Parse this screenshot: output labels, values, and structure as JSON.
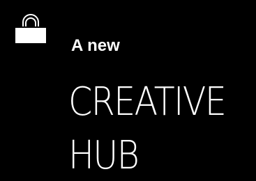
{
  "hero": {
    "icon": "lock-icon",
    "subtitle": "A new",
    "headline_line1": "CREATIVE",
    "headline_line2": "HUB"
  },
  "colors": {
    "background": "#000000",
    "text": "#ffffff"
  }
}
